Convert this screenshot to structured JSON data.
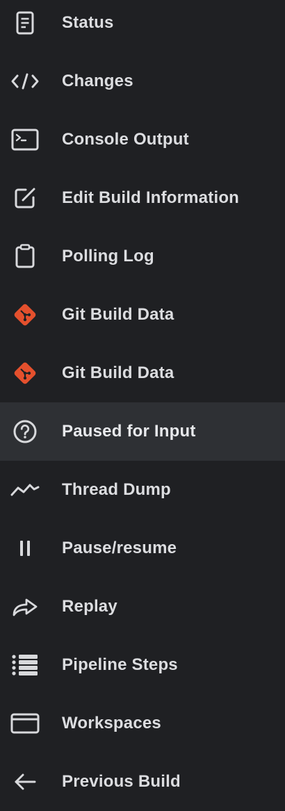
{
  "sidebar": {
    "items": [
      {
        "label": "Status",
        "icon": "document-icon"
      },
      {
        "label": "Changes",
        "icon": "code-icon"
      },
      {
        "label": "Console Output",
        "icon": "terminal-icon"
      },
      {
        "label": "Edit Build Information",
        "icon": "edit-icon"
      },
      {
        "label": "Polling Log",
        "icon": "clipboard-icon"
      },
      {
        "label": "Git Build Data",
        "icon": "git-icon"
      },
      {
        "label": "Git Build Data",
        "icon": "git-icon"
      },
      {
        "label": "Paused for Input",
        "icon": "help-icon",
        "active": true
      },
      {
        "label": "Thread Dump",
        "icon": "activity-icon"
      },
      {
        "label": "Pause/resume",
        "icon": "pause-icon"
      },
      {
        "label": "Replay",
        "icon": "replay-icon"
      },
      {
        "label": "Pipeline Steps",
        "icon": "list-icon"
      },
      {
        "label": "Workspaces",
        "icon": "folder-icon"
      },
      {
        "label": "Previous Build",
        "icon": "arrow-left-icon"
      }
    ]
  },
  "colors": {
    "background": "#1f2023",
    "active_background": "#2e3034",
    "text": "#dcdde0",
    "icon": "#d8d9dc",
    "git_accent": "#e4502d"
  }
}
